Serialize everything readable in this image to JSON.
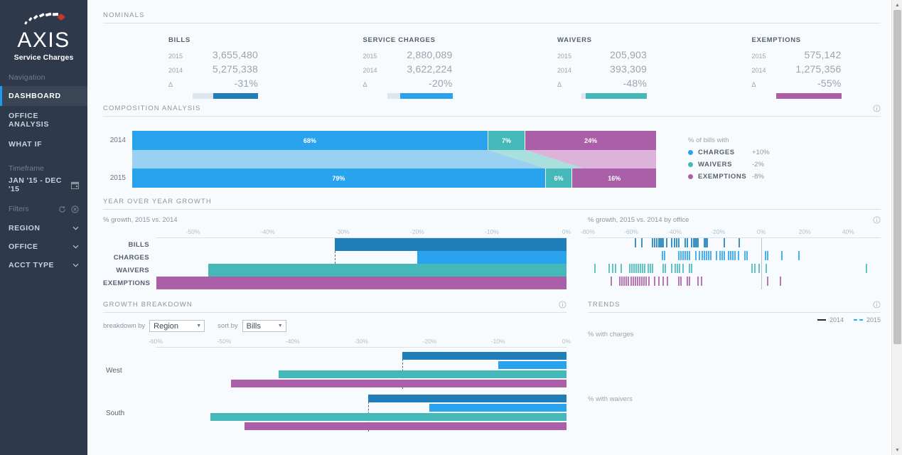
{
  "sidebar": {
    "logo_word": "AXIS",
    "logo_sub": "Service Charges",
    "nav_label": "Navigation",
    "nav_items": [
      {
        "label": "DASHBOARD",
        "active": true
      },
      {
        "label": "OFFICE ANALYSIS",
        "active": false
      },
      {
        "label": "WHAT IF",
        "active": false
      }
    ],
    "timeframe_label": "Timeframe",
    "timeframe_value": "JAN '15 - DEC '15",
    "filters_label": "Filters",
    "filters": [
      {
        "label": "REGION"
      },
      {
        "label": "OFFICE"
      },
      {
        "label": "ACCT TYPE"
      }
    ]
  },
  "colors": {
    "bills": "#1f7eb8",
    "charges": "#2aa3ef",
    "charges_light": "#9ad0f2",
    "waivers": "#45b8ba",
    "waivers_light": "#a9dfdd",
    "exemptions": "#ab5fa8",
    "exemptions_light": "#dcb4da",
    "track": "#dde6ed",
    "sidebar_bg": "#2e3a4b",
    "accent": "#1e9bf0"
  },
  "nominals": {
    "title": "NOMINALS",
    "delta_symbol": "Δ",
    "cards": [
      {
        "title": "BILLS",
        "y1_label": "2015",
        "y1_value": "3,655,480",
        "y2_label": "2014",
        "y2_value": "5,275,338",
        "delta": "-31%",
        "fill_pct": 69,
        "color": "#1f7eb8"
      },
      {
        "title": "SERVICE CHARGES",
        "y1_label": "2015",
        "y1_value": "2,880,089",
        "y2_label": "2014",
        "y2_value": "3,622,224",
        "delta": "-20%",
        "fill_pct": 80,
        "color": "#2aa3ef"
      },
      {
        "title": "WAIVERS",
        "y1_label": "2015",
        "y1_value": "205,903",
        "y2_label": "2014",
        "y2_value": "393,309",
        "delta": "-48%",
        "fill_pct": 93,
        "color": "#45b8ba"
      },
      {
        "title": "EXEMPTIONS",
        "y1_label": "2015",
        "y1_value": "575,142",
        "y2_label": "2014",
        "y2_value": "1,275,356",
        "delta": "-55%",
        "fill_pct": 100,
        "color": "#ab5fa8"
      }
    ]
  },
  "composition": {
    "title": "COMPOSITION ANALYSIS",
    "rows": [
      {
        "year": "2014",
        "segments": [
          {
            "name": "charges",
            "label": "68%",
            "pct": 68,
            "color": "#2aa3ef"
          },
          {
            "name": "waivers",
            "label": "7%",
            "pct": 7,
            "color": "#45b8ba"
          },
          {
            "name": "exemptions",
            "label": "24%",
            "pct": 25,
            "color": "#ab5fa8"
          }
        ]
      },
      {
        "year": "2015",
        "segments": [
          {
            "name": "charges",
            "label": "79%",
            "pct": 79,
            "color": "#2aa3ef"
          },
          {
            "name": "waivers",
            "label": "6%",
            "pct": 5,
            "color": "#45b8ba"
          },
          {
            "name": "exemptions",
            "label": "16%",
            "pct": 16,
            "color": "#ab5fa8"
          }
        ]
      }
    ],
    "legend_title": "% of bills with",
    "legend": [
      {
        "label": "CHARGES",
        "value": "+10%",
        "color": "#2aa3ef"
      },
      {
        "label": "WAIVERS",
        "value": "-2%",
        "color": "#45b8ba"
      },
      {
        "label": "EXEMPTIONS",
        "value": "-8%",
        "color": "#ab5fa8"
      }
    ]
  },
  "yoy": {
    "title": "YEAR OVER YEAR GROWTH",
    "left_sub": "% growth, 2015 vs. 2014",
    "right_sub": "% growth, 2015 vs. 2014 by office"
  },
  "growth_breakdown": {
    "title": "GROWTH BREAKDOWN",
    "breakdown_by_label": "breakdown by",
    "breakdown_by_value": "Region",
    "sort_by_label": "sort by",
    "sort_by_value": "Bills"
  },
  "trends": {
    "title": "TRENDS",
    "legend": [
      {
        "label": "2014",
        "style": "solid",
        "color": "#23282d"
      },
      {
        "label": "2015",
        "style": "dashed",
        "color": "#2ab0f0"
      }
    ],
    "sub_charges": "% with charges",
    "sub_waivers": "% with waivers"
  },
  "chart_data": [
    {
      "type": "bar",
      "id": "yoy-overall",
      "title": "% growth, 2015 vs. 2014",
      "orientation": "horizontal",
      "categories": [
        "BILLS",
        "CHARGES",
        "WAIVERS",
        "EXEMPTIONS"
      ],
      "values": [
        -31,
        -20,
        -48,
        -55
      ],
      "colors": [
        "#1f7eb8",
        "#2aa3ef",
        "#45b8ba",
        "#ab5fa8"
      ],
      "xlim": [
        -55,
        0
      ],
      "xticks": [
        -50,
        -40,
        -30,
        -20,
        -10,
        0
      ],
      "xtick_labels": [
        "-50%",
        "-40%",
        "-30%",
        "-20%",
        "-10%",
        "0%"
      ],
      "reference_line": -31,
      "xlabel": "",
      "ylabel": "",
      "grid": false,
      "legend": "none"
    },
    {
      "type": "scatter",
      "id": "yoy-by-office",
      "title": "% growth, 2015 vs. 2014 by office",
      "subtype": "strip",
      "xlim": [
        -80,
        55
      ],
      "xticks": [
        -80,
        -60,
        -40,
        -20,
        0,
        20,
        40
      ],
      "xtick_labels": [
        "-80%",
        "-60%",
        "-40%",
        "-20%",
        "0%",
        "20%",
        "40%"
      ],
      "reference_line": 0,
      "series": [
        {
          "name": "BILLS",
          "color": "#1f7eb8",
          "values": [
            -58.5,
            -55.5,
            -50.5,
            -49.5,
            -48.5,
            -47.5,
            -46.8,
            -46.2,
            -45.5,
            -44,
            -41.5,
            -40.5,
            -39.5,
            -38.5,
            -35.5,
            -34.5,
            -32.5,
            -31.5,
            -30.8,
            -30.2,
            -29.5,
            -26.5,
            -25.8,
            -25.2,
            -17.5,
            -10.5
          ]
        },
        {
          "name": "CHARGES",
          "color": "#2aa3ef",
          "values": [
            -46,
            -45,
            -38.5,
            -37.5,
            -36.5,
            -35.5,
            -34.5,
            -33.5,
            -30.5,
            -29,
            -27.5,
            -26.5,
            -25.5,
            -24.5,
            -23.5,
            -21,
            -19.5,
            -18.5,
            -17.5,
            -15.5,
            -14.5,
            -13.5,
            -12.5,
            -11,
            -8,
            -7,
            1.5,
            2.5,
            9,
            17
          ]
        },
        {
          "name": "WAIVERS",
          "color": "#45b8ba",
          "values": [
            -77,
            -70.5,
            -69,
            -67.5,
            -65,
            -61,
            -60,
            -59,
            -58,
            -57,
            -56,
            -55,
            -54,
            -52.5,
            -51.5,
            -50.5,
            -45.5,
            -44.5,
            -41.5,
            -40,
            -39,
            -38,
            -36.5,
            -33.5,
            -32.5,
            -4.5,
            -3.2,
            -1.5,
            2,
            48
          ]
        },
        {
          "name": "EXEMPTIONS",
          "color": "#ab5fa8",
          "values": [
            -69.5,
            -65.5,
            -64.5,
            -63.5,
            -62.5,
            -61.5,
            -60.5,
            -59.5,
            -58.5,
            -57.5,
            -56.5,
            -55.5,
            -54.5,
            -53.5,
            -52,
            -49.5,
            -47.5,
            -45.5,
            -43.5,
            -38.5,
            -37.5,
            -34.5,
            -33.5,
            -29.5,
            -28,
            2.5,
            8.5
          ]
        }
      ]
    },
    {
      "type": "bar",
      "id": "growth-breakdown",
      "title": "GROWTH BREAKDOWN",
      "orientation": "horizontal",
      "breakdown_by": "Region",
      "sort_by": "Bills",
      "xlim": [
        -60,
        0
      ],
      "xticks": [
        -60,
        -50,
        -40,
        -30,
        -20,
        -10,
        0
      ],
      "xtick_labels": [
        "-60%",
        "-50%",
        "-40%",
        "-30%",
        "-20%",
        "-10%",
        "0%"
      ],
      "categories": [
        "West",
        "South"
      ],
      "series": [
        {
          "name": "Bills",
          "color": "#1f7eb8",
          "values": [
            -24,
            -29
          ]
        },
        {
          "name": "Charges",
          "color": "#2aa3ef",
          "values": [
            -10,
            -20
          ]
        },
        {
          "name": "Waivers",
          "color": "#45b8ba",
          "values": [
            -42,
            -52
          ]
        },
        {
          "name": "Exemptions",
          "color": "#ab5fa8",
          "values": [
            -49,
            -47
          ]
        }
      ],
      "reference_lines": [
        -24,
        -29
      ]
    },
    {
      "type": "line",
      "id": "trends",
      "title": "TRENDS",
      "panels": [
        "% with charges",
        "% with waivers"
      ],
      "series": [
        {
          "name": "2014",
          "style": "solid",
          "color": "#23282d",
          "values": []
        },
        {
          "name": "2015",
          "style": "dashed",
          "color": "#2ab0f0",
          "values": []
        }
      ]
    }
  ]
}
